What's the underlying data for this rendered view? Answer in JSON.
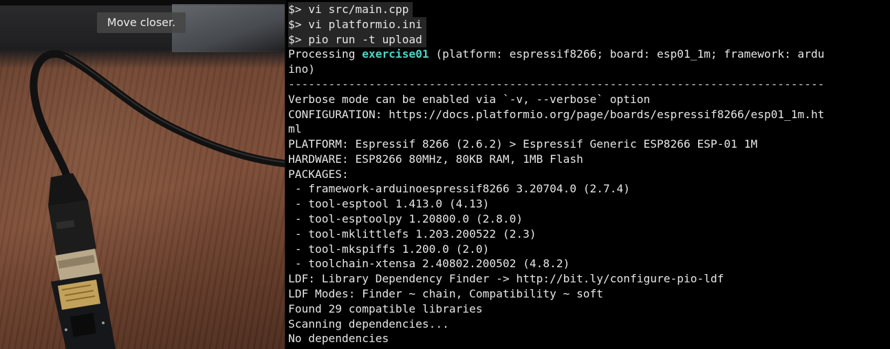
{
  "camera": {
    "notice": "Move closer."
  },
  "terminal": {
    "lines": [
      {
        "text": "$> vi src/main.cpp"
      },
      {
        "text": "$> vi platformio.ini"
      },
      {
        "text": "$> pio run -t upload"
      },
      {
        "pre": "Processing ",
        "highlight": "exercise01",
        "post": " (platform: espressif8266; board: esp01_1m; framework: ardu"
      },
      {
        "text": "ino)"
      },
      {
        "text": "--------------------------------------------------------------------------------"
      },
      {
        "text": "Verbose mode can be enabled via `-v, --verbose` option"
      },
      {
        "text": "CONFIGURATION: https://docs.platformio.org/page/boards/espressif8266/esp01_1m.ht"
      },
      {
        "text": "ml"
      },
      {
        "text": "PLATFORM: Espressif 8266 (2.6.2) > Espressif Generic ESP8266 ESP-01 1M"
      },
      {
        "text": "HARDWARE: ESP8266 80MHz, 80KB RAM, 1MB Flash"
      },
      {
        "text": "PACKAGES:"
      },
      {
        "text": " - framework-arduinoespressif8266 3.20704.0 (2.7.4)"
      },
      {
        "text": " - tool-esptool 1.413.0 (4.13)"
      },
      {
        "text": " - tool-esptoolpy 1.20800.0 (2.8.0)"
      },
      {
        "text": " - tool-mklittlefs 1.203.200522 (2.3)"
      },
      {
        "text": " - tool-mkspiffs 1.200.0 (2.0)"
      },
      {
        "text": " - toolchain-xtensa 2.40802.200502 (4.8.2)"
      },
      {
        "text": "LDF: Library Dependency Finder -> http://bit.ly/configure-pio-ldf"
      },
      {
        "text": "LDF Modes: Finder ~ chain, Compatibility ~ soft"
      },
      {
        "text": "Found 29 compatible libraries"
      },
      {
        "text": "Scanning dependencies..."
      },
      {
        "text": "No dependencies"
      }
    ]
  },
  "colors": {
    "terminal_bg": "#000000",
    "terminal_fg": "#e6e6e6",
    "highlight": "#4cd6c6",
    "prompt_bg": "#262626"
  }
}
